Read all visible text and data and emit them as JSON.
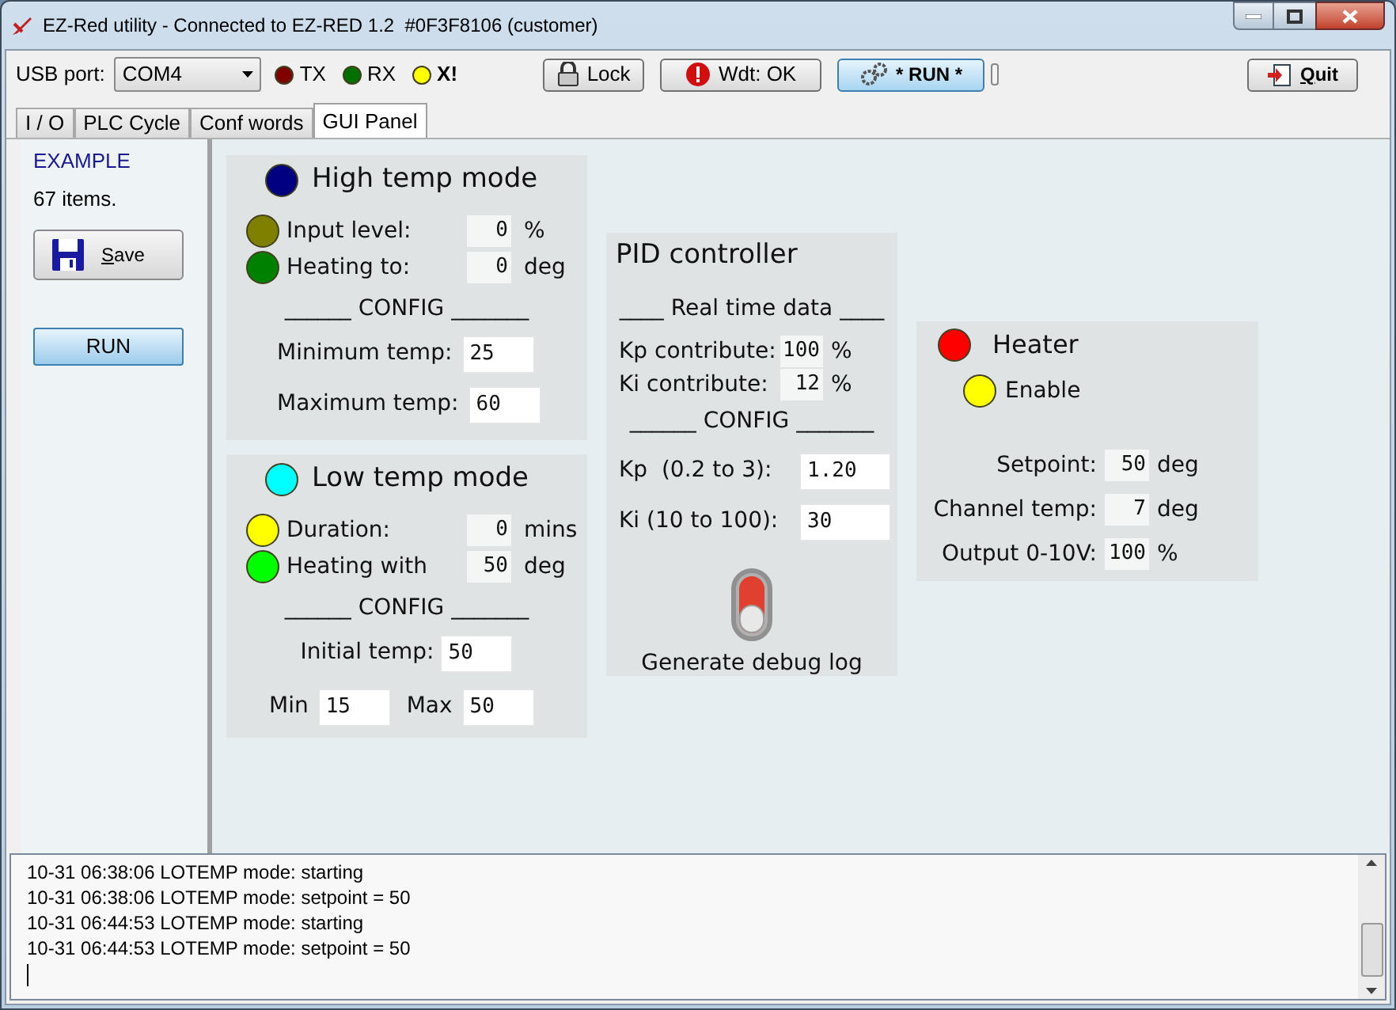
{
  "window": {
    "title": "EZ-Red utility - Connected to EZ-RED 1.2  #0F3F8106 (customer)"
  },
  "toolbar": {
    "usb_label": "USB port:",
    "port": "COM4",
    "indicators": [
      {
        "label": "TX",
        "color": "#800000",
        "bold": false
      },
      {
        "label": "RX",
        "color": "#007000",
        "bold": false
      },
      {
        "label": "X!",
        "color": "#ffff00",
        "bold": true
      }
    ],
    "buttons": [
      {
        "label": "Lock",
        "kind": "lock"
      },
      {
        "label": "Wdt: OK",
        "kind": "warning"
      },
      {
        "label": "* RUN *",
        "kind": "run"
      },
      {
        "label": "Quit",
        "kind": "quit"
      }
    ]
  },
  "tabs": [
    {
      "label": "I / O",
      "selected": false
    },
    {
      "label": "PLC Cycle",
      "selected": false
    },
    {
      "label": "Conf words",
      "selected": false
    },
    {
      "label": "GUI Panel",
      "selected": true
    }
  ],
  "sidebar": {
    "title": "EXAMPLE",
    "count": "67 items.",
    "buttons": [
      {
        "label": "Save",
        "kind": "save"
      },
      {
        "label": "RUN",
        "kind": "run"
      }
    ]
  },
  "panels": [
    {
      "title": "High temp mode",
      "color": "#000080",
      "rows": [
        {
          "kind": "indicator",
          "color": "#808000",
          "label": "Input level:",
          "value": "0",
          "unit": "%"
        },
        {
          "kind": "indicator",
          "color": "#008000",
          "label": "Heating to:",
          "value": "0",
          "unit": "deg"
        },
        {
          "kind": "heading",
          "text": "______ CONFIG _______"
        },
        {
          "kind": "field",
          "label": "Minimum temp:",
          "value": "25"
        },
        {
          "kind": "field",
          "label": "Maximum temp:",
          "value": "60"
        }
      ]
    },
    {
      "title": "Low temp mode",
      "color": "#00ffff",
      "rows": [
        {
          "kind": "indicator",
          "color": "#ffff00",
          "label": "Duration:",
          "value": "0",
          "unit": "mins"
        },
        {
          "kind": "indicator",
          "color": "#00ff00",
          "label": "Heating with",
          "value": "50",
          "unit": "deg"
        },
        {
          "kind": "heading",
          "text": "______ CONFIG _______"
        },
        {
          "kind": "field",
          "label": "Initial temp:",
          "value": "50"
        },
        {
          "kind": "pair",
          "fields": [
            {
              "label": "Min",
              "value": "15"
            },
            {
              "label": "Max",
              "value": "50"
            }
          ]
        }
      ]
    },
    {
      "title": "PID controller",
      "rows": [
        {
          "kind": "heading",
          "text": "____ Real time data ____"
        },
        {
          "kind": "readout",
          "label": "Kp contribute:",
          "value": "100",
          "unit": "%"
        },
        {
          "kind": "readout",
          "label": "Ki contribute:",
          "value": "12",
          "unit": "%"
        },
        {
          "kind": "heading",
          "text": "______ CONFIG _______"
        },
        {
          "kind": "field",
          "label": "Kp  (0.2 to 3):",
          "value": "1.20"
        },
        {
          "kind": "field",
          "label": "Ki (10 to 100):",
          "value": "30"
        },
        {
          "kind": "toggle",
          "label": "Generate debug log",
          "on": false
        }
      ]
    },
    {
      "title": "Heater",
      "color": "#ff0000",
      "rows": [
        {
          "kind": "indicator",
          "color": "#ffff00",
          "label": "Enable"
        },
        {
          "kind": "readout",
          "label": "Setpoint:",
          "value": "50",
          "unit": "deg"
        },
        {
          "kind": "readout",
          "label": "Channel temp:",
          "value": "7",
          "unit": "deg"
        },
        {
          "kind": "readout",
          "label": "Output 0-10V:",
          "value": "100",
          "unit": "%"
        }
      ]
    }
  ],
  "log": {
    "lines": [
      "10-31 06:38:06 LOTEMP mode: starting",
      "10-31 06:38:06 LOTEMP mode: setpoint = 50",
      "10-31 06:44:53 LOTEMP mode: starting",
      "10-31 06:44:53 LOTEMP mode: setpoint = 50"
    ]
  }
}
